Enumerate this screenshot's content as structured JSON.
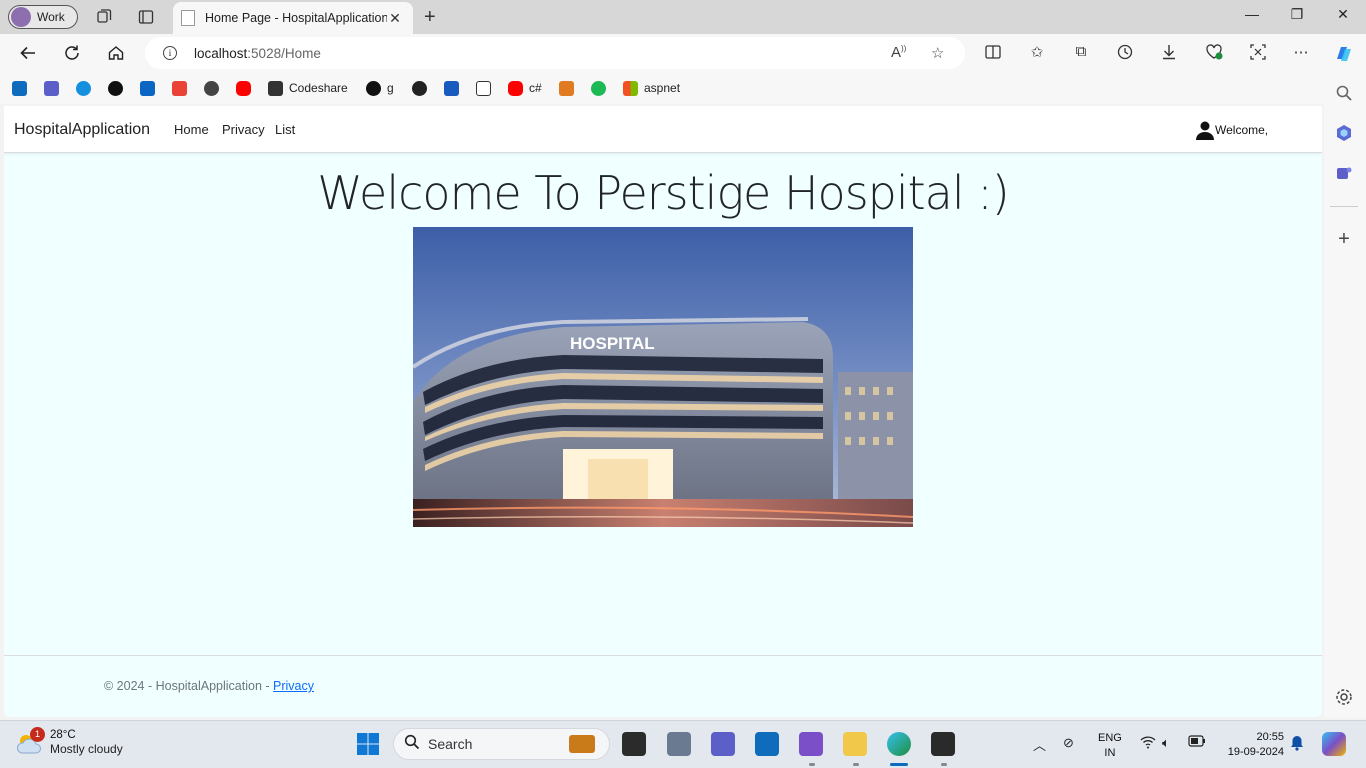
{
  "browser": {
    "profile_label": "Work",
    "tab_title": "Home Page - HospitalApplication",
    "url_host": "localhost",
    "url_rest": ":5028/Home",
    "favorites": [
      {
        "label": "",
        "color": "#0f6cbd"
      },
      {
        "label": "",
        "color": "#5b5fc7"
      },
      {
        "label": "",
        "color": "#1490df"
      },
      {
        "label": "",
        "color": "#111111"
      },
      {
        "label": "",
        "color": "#0a66c2"
      },
      {
        "label": "",
        "color": "#ea4335"
      },
      {
        "label": "",
        "color": "#444444"
      },
      {
        "label": "",
        "color": "#ff0000"
      },
      {
        "label": "Codeshare",
        "color": "#333333"
      },
      {
        "label": "g",
        "color": "#111111"
      },
      {
        "label": "",
        "color": "#222222"
      },
      {
        "label": "",
        "color": "#185abd"
      },
      {
        "label": "",
        "color": "#333333"
      },
      {
        "label": "c#",
        "color": "#ff0000"
      },
      {
        "label": "",
        "color": "#e07b22"
      },
      {
        "label": "",
        "color": "#1db954"
      },
      {
        "label": "aspnet",
        "color": "#f25022"
      }
    ]
  },
  "site": {
    "brand": "HospitalApplication",
    "nav_links": [
      "Home",
      "Privacy",
      "List"
    ],
    "welcome_text": "Welcome,",
    "headline": "Welcome To Perstige Hospital :)",
    "hero_sign": "HOSPITAL",
    "footer_text": "© 2024 - HospitalApplication - ",
    "footer_link": "Privacy"
  },
  "taskbar": {
    "weather_badge": "1",
    "temperature": "28°C",
    "condition": "Mostly cloudy",
    "search_label": "Search",
    "lang_top": "ENG",
    "lang_bottom": "IN",
    "time": "20:55",
    "date": "19-09-2024"
  },
  "colors": {
    "page_background": "#f0ffff",
    "link": "#0d6efd",
    "taskbar": "#e3e7ee"
  }
}
